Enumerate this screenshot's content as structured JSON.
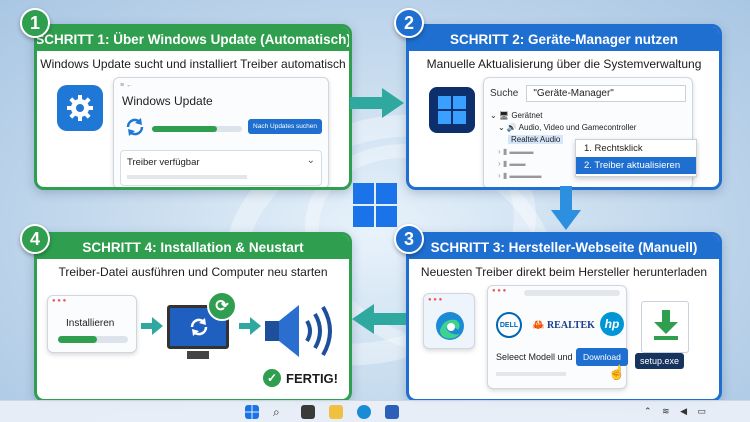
{
  "steps": [
    {
      "number": "1",
      "title": "SCHRITT 1: Über Windows Update (Automatisch)",
      "subtitle": "Windows Update sucht und installiert Treiber automatisch"
    },
    {
      "number": "2",
      "title": "SCHRITT 2: Geräte-Manager nutzen",
      "subtitle": "Manuelle Aktualisierung über die Systemverwaltung"
    },
    {
      "number": "3",
      "title": "SCHRITT 3: Hersteller-Webseite (Manuell)",
      "subtitle": "Neuesten Treiber direkt beim Hersteller herunterladen"
    },
    {
      "number": "4",
      "title": "SCHRITT 4: Installation & Neustart",
      "subtitle": "Treiber-Datei ausführen und Computer neu starten"
    }
  ],
  "step1": {
    "window_title": "Windows Update",
    "check_button": "Nach Updates suchen",
    "progress": 0.72,
    "dropdown_label": "Treiber verfügbar"
  },
  "step2": {
    "search_label": "Suche",
    "search_value": "\"Geräte-Manager\"",
    "tree_root": "Gerätnet",
    "tree_category": "Audio, Video und Gamecontroller",
    "tree_device": "Realtek Audio",
    "menu_item_1": "1. Rechtsklick",
    "menu_item_2": "2. Treiber aktualisieren"
  },
  "step3": {
    "brand_1": "DELL",
    "brand_2": "REALTEK",
    "brand_3": "hp",
    "select_text": "Seleect Modell und",
    "download_button": "Download",
    "file_name": "setup.exe"
  },
  "step4": {
    "install_label": "Installieren",
    "install_progress": 0.55,
    "done_label": "FERTIG!"
  },
  "colors": {
    "green": "#2f9e4e",
    "blue": "#1f6fd0"
  }
}
